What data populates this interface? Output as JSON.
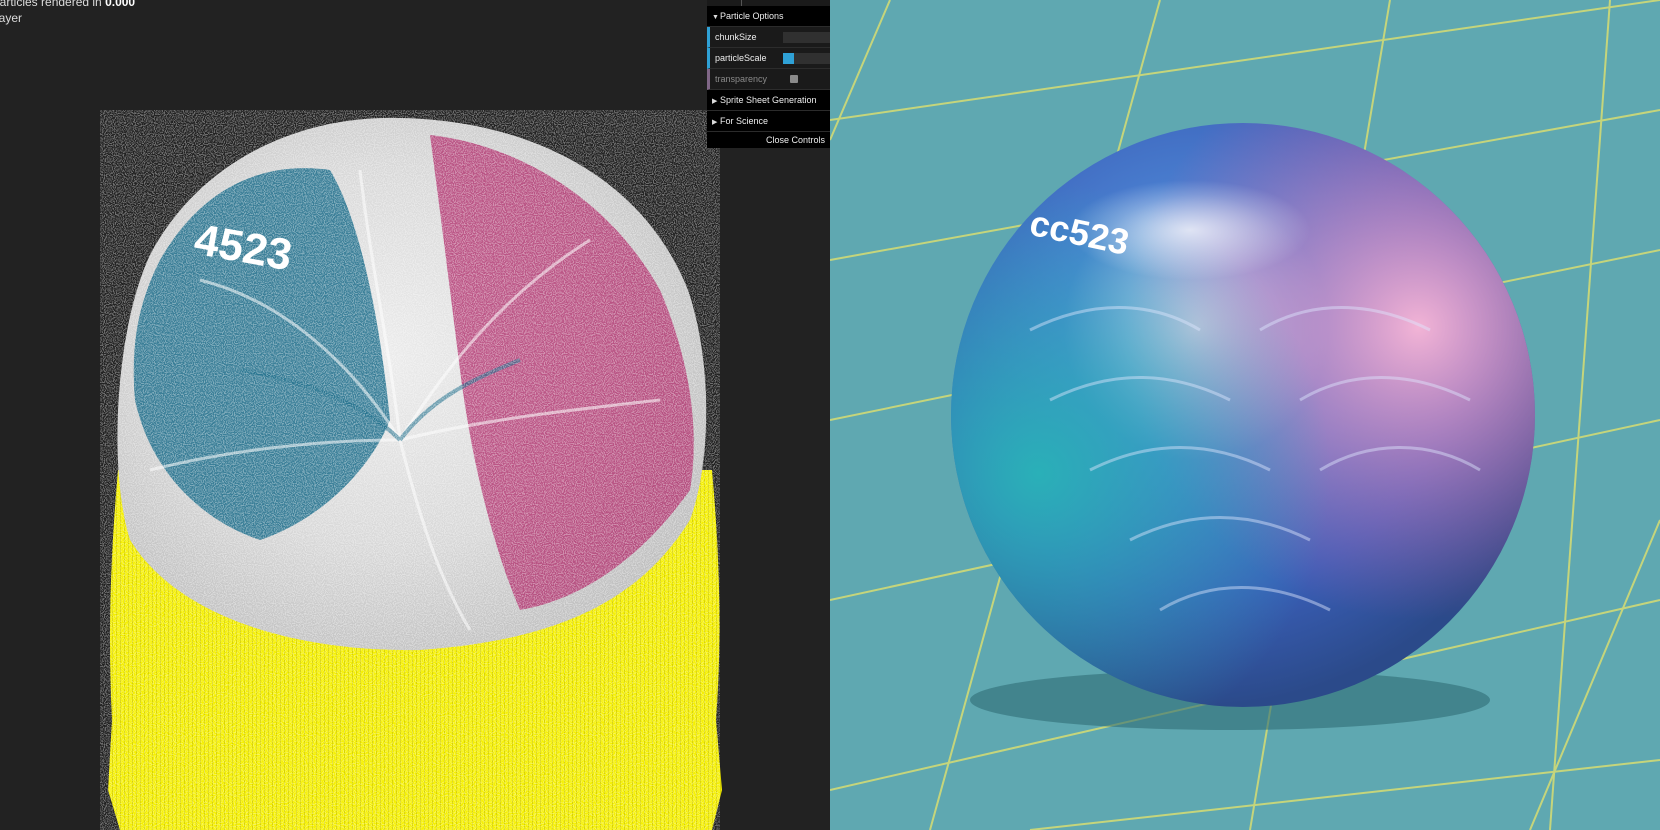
{
  "info": {
    "text_prefix": "particles rendered in ",
    "text_bold": "0.000",
    "text_line2": "layer"
  },
  "gui": {
    "folders": [
      {
        "label": "Particle Options",
        "expanded": true
      },
      {
        "label": "Sprite Sheet Generation",
        "expanded": false
      },
      {
        "label": "For Science",
        "expanded": false
      }
    ],
    "controls": {
      "chunkSize": {
        "label": "chunkSize",
        "fill": 0.0
      },
      "particleScale": {
        "label": "particleScale",
        "fill": 0.18
      },
      "transparency": {
        "label": "transparency",
        "checked": false
      }
    },
    "close_label": "Close Controls",
    "accent_color": "#2fa1d6"
  },
  "render": {
    "model_label": "4523",
    "colors": {
      "teal": "#1f6f8c",
      "magenta": "#b02a6a",
      "white": "#f2f2f2",
      "yellow": "#f4f000",
      "background": "#222222"
    }
  },
  "photo": {
    "engraving": "cc523",
    "colors": {
      "mat": "#5fa8b1",
      "gridline": "#e8e46a"
    }
  }
}
